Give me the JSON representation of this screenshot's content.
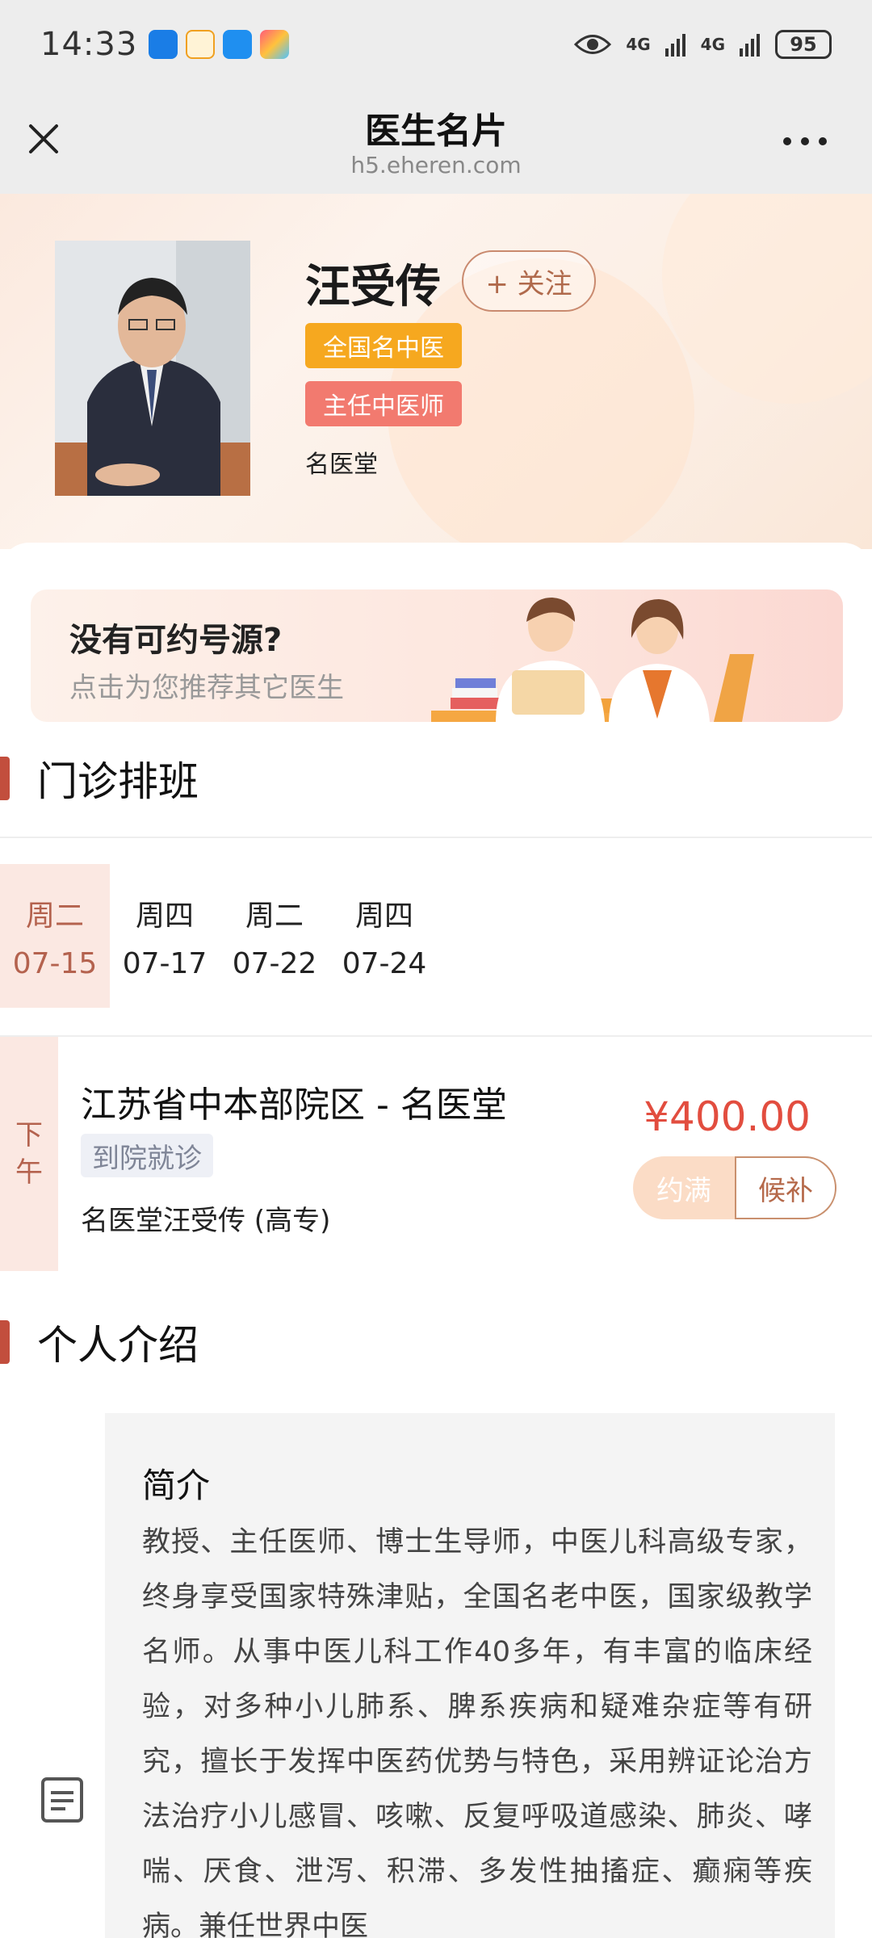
{
  "status_bar": {
    "time": "14:33",
    "network_1": "4G",
    "network_2": "4G",
    "battery": "95",
    "icons": [
      "app-blue-icon",
      "app-yellow-icon",
      "cloud-icon",
      "app-color-icon",
      "eye-icon",
      "signal-icon"
    ]
  },
  "title_bar": {
    "title": "医生名片",
    "url": "h5.eheren.com",
    "icons": [
      "close-icon",
      "more-icon"
    ]
  },
  "profile": {
    "name": "汪受传",
    "follow_label": "+ 关注",
    "tag_1": "全国名中医",
    "tag_2": "主任中医师",
    "hospital": "名医堂",
    "colors": {
      "tag_1": "#f6a81f",
      "tag_2": "#f27a6f"
    }
  },
  "recommend": {
    "title": "没有可约号源?",
    "subtitle": "点击为您推荐其它医生"
  },
  "schedule_section": {
    "title": "门诊排班",
    "dates": [
      {
        "day": "周二",
        "date": "07-15",
        "selected": true
      },
      {
        "day": "周四",
        "date": "07-17",
        "selected": false
      },
      {
        "day": "周二",
        "date": "07-22",
        "selected": false
      },
      {
        "day": "周四",
        "date": "07-24",
        "selected": false
      }
    ],
    "slot": {
      "period": "下午",
      "period_chars": [
        "下",
        "午"
      ],
      "clinic": "江苏省中本部院区 - 名医堂",
      "visit_type": "到院就诊",
      "doctor_desc": "名医堂汪受传 (高专)",
      "price": "¥400.00",
      "full_label": "约满",
      "waitlist_label": "候补"
    }
  },
  "intro_section": {
    "title": "个人介绍",
    "box_title": "简介",
    "text": "教授、主任医师、博士生导师，中医儿科高级专家，终身享受国家特殊津贴，全国名老中医，国家级教学名师。从事中医儿科工作40多年，有丰富的临床经验，对多种小儿肺系、脾系疾病和疑难杂症等有研究，擅长于发挥中医药优势与特色，采用辨证论治方法治疗小儿感冒、咳嗽、反复呼吸道感染、肺炎、哮喘、厌食、泄泻、积滞、多发性抽搐症、癫痫等疾病。兼任世界中医"
  },
  "accent_color": "#c24e3d"
}
